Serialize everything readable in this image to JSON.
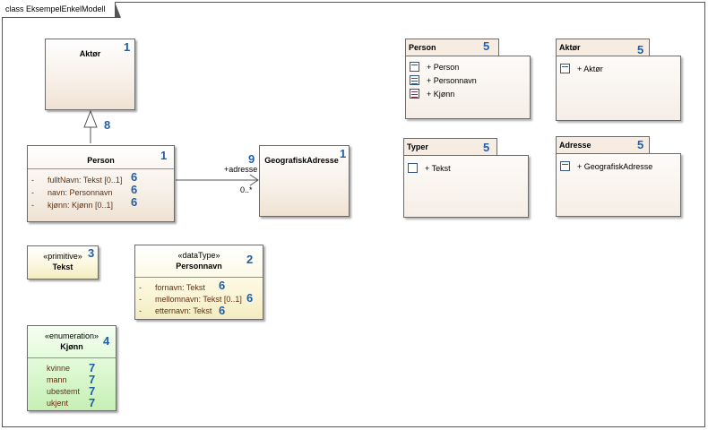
{
  "frame": {
    "title": "class EksempelEnkelModell"
  },
  "classes": {
    "aktor": {
      "name": "Aktør",
      "num": "1"
    },
    "person": {
      "name": "Person",
      "num": "1",
      "attrs": [
        {
          "vis": "-",
          "text": "fulltNavn: Tekst [0..1]",
          "num": "6"
        },
        {
          "vis": "-",
          "text": "navn: Personnavn",
          "num": "6"
        },
        {
          "vis": "-",
          "text": "kjønn: Kjønn [0..1]",
          "num": "6"
        }
      ]
    },
    "geografisk": {
      "name": "GeografiskAdresse",
      "num": "1"
    },
    "tekst": {
      "stereotype": "«primitive»",
      "name": "Tekst",
      "num": "3"
    },
    "personnavn": {
      "stereotype": "«dataType»",
      "name": "Personnavn",
      "num": "2",
      "attrs": [
        {
          "vis": "-",
          "text": "fornavn: Tekst",
          "num": "6"
        },
        {
          "vis": "-",
          "text": "mellomnavn: Tekst [0..1]",
          "num": "6"
        },
        {
          "vis": "-",
          "text": "etternavn: Tekst",
          "num": "6"
        }
      ]
    },
    "kjonn": {
      "stereotype": "«enumeration»",
      "name": "Kjønn",
      "num": "4",
      "literals": [
        {
          "text": "kvinne",
          "num": "7"
        },
        {
          "text": "mann",
          "num": "7"
        },
        {
          "text": "ubestemt",
          "num": "7"
        },
        {
          "text": "ukjent",
          "num": "7"
        }
      ]
    }
  },
  "generalization": {
    "num": "8"
  },
  "association": {
    "role": "+adresse",
    "multiplicity": "0..*",
    "num": "9"
  },
  "packages": {
    "person": {
      "name": "Person",
      "num": "5",
      "items": [
        "+ Person",
        "+ Personnavn",
        "+ Kjønn"
      ]
    },
    "aktor": {
      "name": "Aktør",
      "num": "5",
      "items": [
        "+ Aktør"
      ]
    },
    "typer": {
      "name": "Typer",
      "num": "5",
      "items": [
        "+ Tekst"
      ]
    },
    "adresse": {
      "name": "Adresse",
      "num": "5",
      "items": [
        "+ GeografiskAdresse"
      ]
    }
  }
}
